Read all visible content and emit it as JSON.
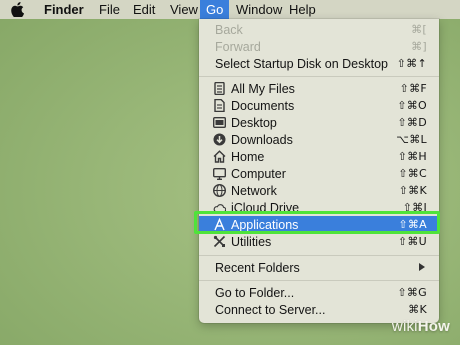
{
  "menubar": {
    "apple_icon": "apple-icon",
    "finder": "Finder",
    "file": "File",
    "edit": "Edit",
    "view": "View",
    "go": "Go",
    "window": "Window",
    "help": "Help"
  },
  "go_menu": {
    "items": [
      {
        "label": "Back",
        "shortcut": "⌘[",
        "enabled": false
      },
      {
        "label": "Forward",
        "shortcut": "⌘]",
        "enabled": false
      },
      {
        "label": "Select Startup Disk on Desktop",
        "shortcut": "⇧⌘↑",
        "enabled": true
      },
      {
        "label": "All My Files",
        "shortcut": "⇧⌘F",
        "icon": "all-my-files-icon"
      },
      {
        "label": "Documents",
        "shortcut": "⇧⌘O",
        "icon": "documents-icon"
      },
      {
        "label": "Desktop",
        "shortcut": "⇧⌘D",
        "icon": "desktop-icon"
      },
      {
        "label": "Downloads",
        "shortcut": "⌥⌘L",
        "icon": "downloads-icon"
      },
      {
        "label": "Home",
        "shortcut": "⇧⌘H",
        "icon": "home-icon"
      },
      {
        "label": "Computer",
        "shortcut": "⇧⌘C",
        "icon": "computer-icon"
      },
      {
        "label": "Network",
        "shortcut": "⇧⌘K",
        "icon": "network-icon"
      },
      {
        "label": "iCloud Drive",
        "shortcut": "⇧⌘I",
        "icon": "icloud-icon"
      },
      {
        "label": "Applications",
        "shortcut": "⇧⌘A",
        "icon": "applications-icon",
        "selected": true
      },
      {
        "label": "Utilities",
        "shortcut": "⇧⌘U",
        "icon": "utilities-icon"
      },
      {
        "label": "Recent Folders",
        "submenu": true
      },
      {
        "label": "Go to Folder...",
        "shortcut": "⇧⌘G"
      },
      {
        "label": "Connect to Server...",
        "shortcut": "⌘K"
      }
    ]
  },
  "colors": {
    "selection": "#3a7fdc",
    "highlight_outline": "#4fe33a",
    "desktop": "#98b677"
  },
  "watermark": {
    "wiki": "wiki",
    "how": "How"
  }
}
